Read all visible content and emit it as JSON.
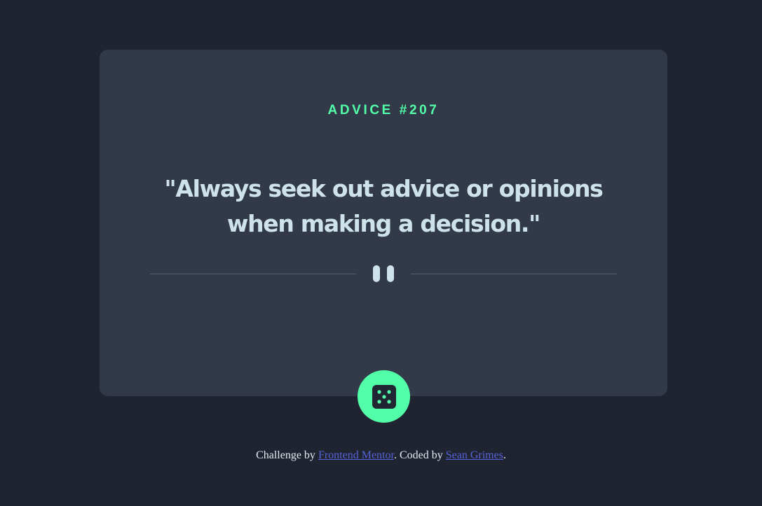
{
  "card": {
    "advice_id": "ADVICE #207",
    "quote": "\"Always seek out advice or opinions when making a decision.\""
  },
  "dice_button": {
    "icon": "dice-icon"
  },
  "divider": {
    "icon": "pause-icon"
  },
  "footer": {
    "prefix": "Challenge by ",
    "link1": "Frontend Mentor",
    "middle": ". Coded by ",
    "link2": "Sean Grimes",
    "suffix": "."
  },
  "colors": {
    "background": "#1f2430",
    "card": "#323a4a",
    "accent": "#52ffa8",
    "text": "#cee3e9",
    "link": "#5563d9"
  }
}
